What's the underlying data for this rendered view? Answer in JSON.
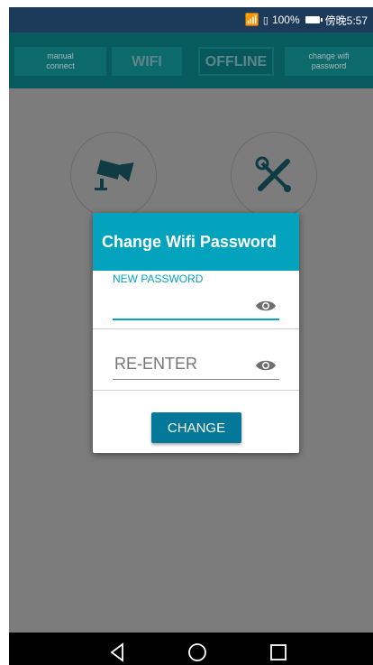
{
  "status_bar": {
    "battery_percent": "100%",
    "time": "傍晚5:57"
  },
  "top_nav": {
    "manual_connect": "manual connect",
    "wifi": "WIFI",
    "offline": "OFFLINE",
    "change_wifi_password": "change wifi password"
  },
  "home_icons": [
    "camera-icon",
    "tools-icon"
  ],
  "dialog": {
    "title": "Change Wifi Password",
    "new_password_label": "NEW PASSWORD",
    "new_password_value": "",
    "reenter_placeholder": "RE-ENTER",
    "change_button": "CHANGE"
  },
  "colors": {
    "accent": "#03a3be",
    "button": "#037898",
    "nav_bg": "#085b5c"
  }
}
